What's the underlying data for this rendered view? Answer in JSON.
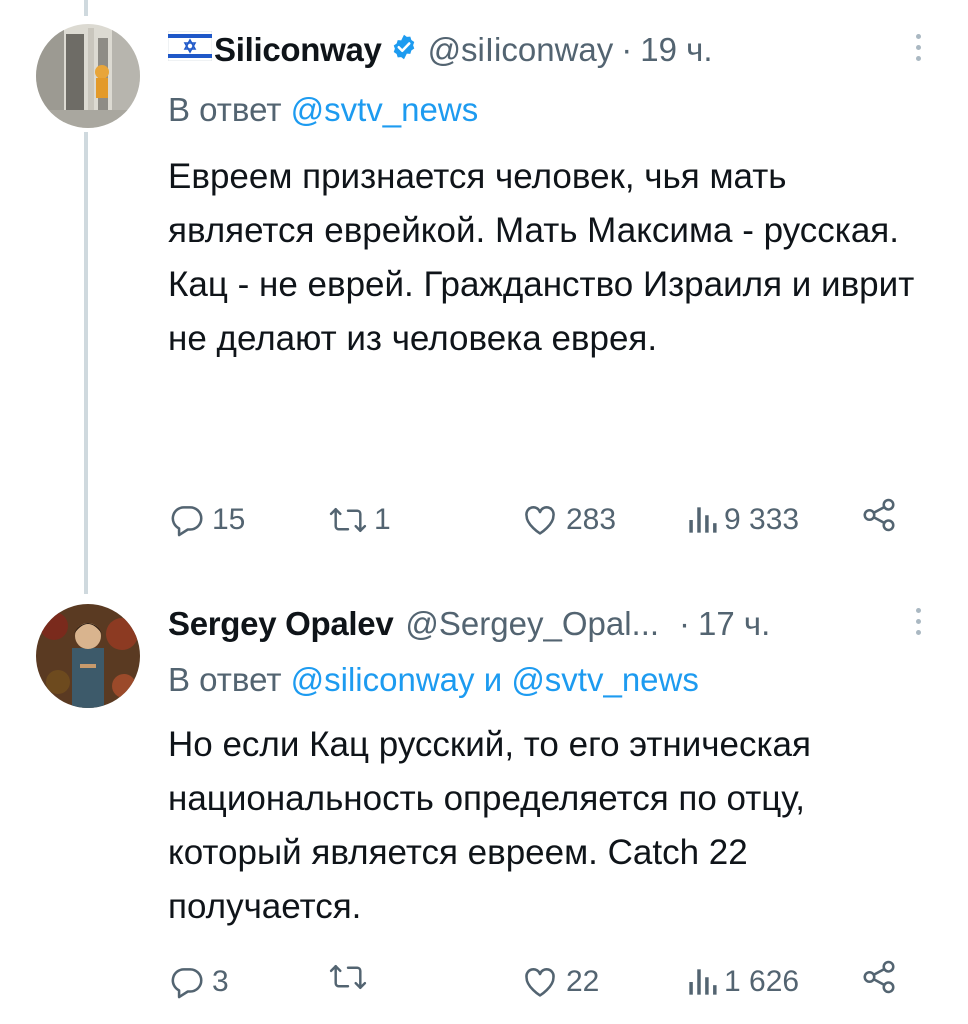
{
  "tweets": [
    {
      "name": "Siliconway",
      "handle": "@siIiconway",
      "dot": "·",
      "time": "19 ч.",
      "reply_prefix": "В ответ",
      "reply_to": "@svtv_news",
      "text": "Евреем признается человек, чья мать является еврейкой. Мать Максима - русская. Кац - не еврей. Гражданство Израиля и иврит не делают из человека еврея.",
      "replies": "15",
      "reposts": "1",
      "likes": "283",
      "views": "9 333"
    },
    {
      "name": "Sergey Opalev",
      "handle": "@Sergey_Opal...",
      "dot": "·",
      "time": "17 ч.",
      "reply_prefix": "В ответ",
      "reply_to_1": "@siliconway",
      "reply_and": "и",
      "reply_to_2": "@svtv_news",
      "text": "Но если Кац русский, то его этническая национальность определяется по отцу, который является евреем. Catch 22 получается.",
      "replies": "3",
      "reposts": "",
      "likes": "22",
      "views": "1 626"
    }
  ],
  "icons": {
    "reply": "reply-icon",
    "repost": "repost-icon",
    "like": "heart-icon",
    "views": "views-icon",
    "share": "share-icon",
    "verified": "verified-badge-icon",
    "flag": "israel-flag-icon",
    "more": "more-icon"
  },
  "colors": {
    "text": "#0f1419",
    "muted": "#536471",
    "link": "#1d9bf0",
    "thread_line": "#cfd9de"
  }
}
